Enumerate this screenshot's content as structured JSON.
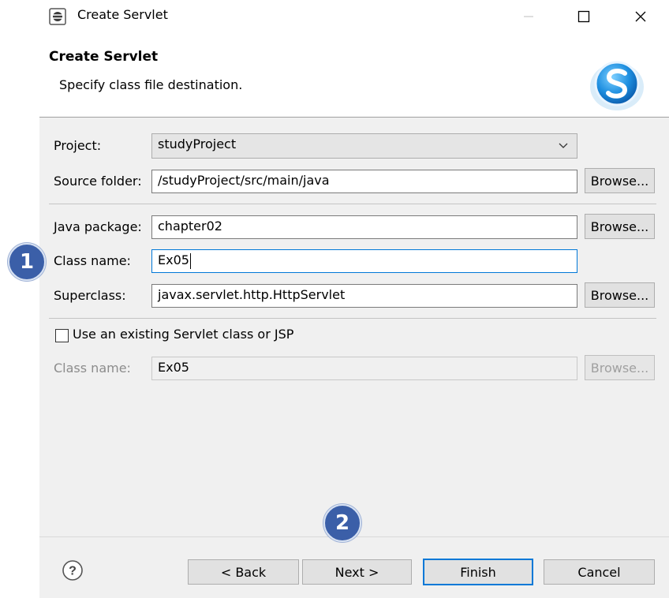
{
  "window": {
    "title": "Create Servlet",
    "minimize_icon": "minimize-icon",
    "maximize_icon": "maximize-icon",
    "close_icon": "close-icon"
  },
  "header": {
    "title": "Create Servlet",
    "description": "Specify class file destination.",
    "logo_icon": "servlet-s-logo"
  },
  "form": {
    "project_label": "Project:",
    "project_value": "studyProject",
    "source_folder_label": "Source folder:",
    "source_folder_value": "/studyProject/src/main/java",
    "java_package_label": "Java package:",
    "java_package_value": "chapter02",
    "class_name_label": "Class name:",
    "class_name_value": "Ex05",
    "superclass_label": "Superclass:",
    "superclass_value": "javax.servlet.http.HttpServlet",
    "browse_label": "Browse...",
    "existing_checkbox_label": "Use an existing Servlet class or JSP",
    "existing_checked": false,
    "existing_class_label": "Class name:",
    "existing_class_value": "Ex05"
  },
  "buttons": {
    "back": "< Back",
    "next": "Next >",
    "finish": "Finish",
    "cancel": "Cancel",
    "help_icon": "help-question-icon"
  },
  "annotations": {
    "step1": "1",
    "step2": "2",
    "color": "#3b5fa8"
  }
}
